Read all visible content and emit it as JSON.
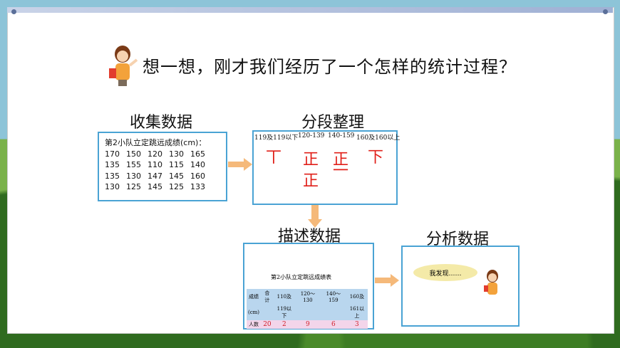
{
  "title": "想一想，刚才我们经历了一个怎样的统计过程？",
  "steps": {
    "collect": "收集数据",
    "organize": "分段整理",
    "describe": "描述数据",
    "analyze": "分析数据"
  },
  "raw_data": {
    "caption": "第2小队立定跳远成绩(cm)：",
    "rows": [
      [
        "170",
        "150",
        "120",
        "130",
        "165"
      ],
      [
        "135",
        "155",
        "110",
        "115",
        "140"
      ],
      [
        "135",
        "130",
        "147",
        "145",
        "160"
      ],
      [
        "130",
        "125",
        "145",
        "125",
        "133"
      ]
    ]
  },
  "tally": {
    "headers": [
      "119及119以下",
      "120-139",
      "140-159",
      "160及160以上"
    ],
    "marks": [
      "丅",
      "正",
      "正",
      "下"
    ],
    "marks2": [
      "",
      "正",
      "一",
      ""
    ]
  },
  "stat_table": {
    "caption": "第2小队立定跳远成绩表",
    "header1": [
      "成绩",
      "合计",
      "110及",
      "120～130",
      "140～159",
      "160及"
    ],
    "header2": [
      "(cm)",
      "",
      "119以下",
      "",
      "",
      "161以上"
    ],
    "label": "人数",
    "values": [
      "20",
      "2",
      "9",
      "6",
      "3"
    ]
  },
  "bubble": "我发现……",
  "colors": {
    "box_border": "#4aa3d4",
    "tally": "#e0201a",
    "arrow": "#f5b97a",
    "table_header": "#b9d6ee",
    "table_row": "#f3d5ea"
  }
}
